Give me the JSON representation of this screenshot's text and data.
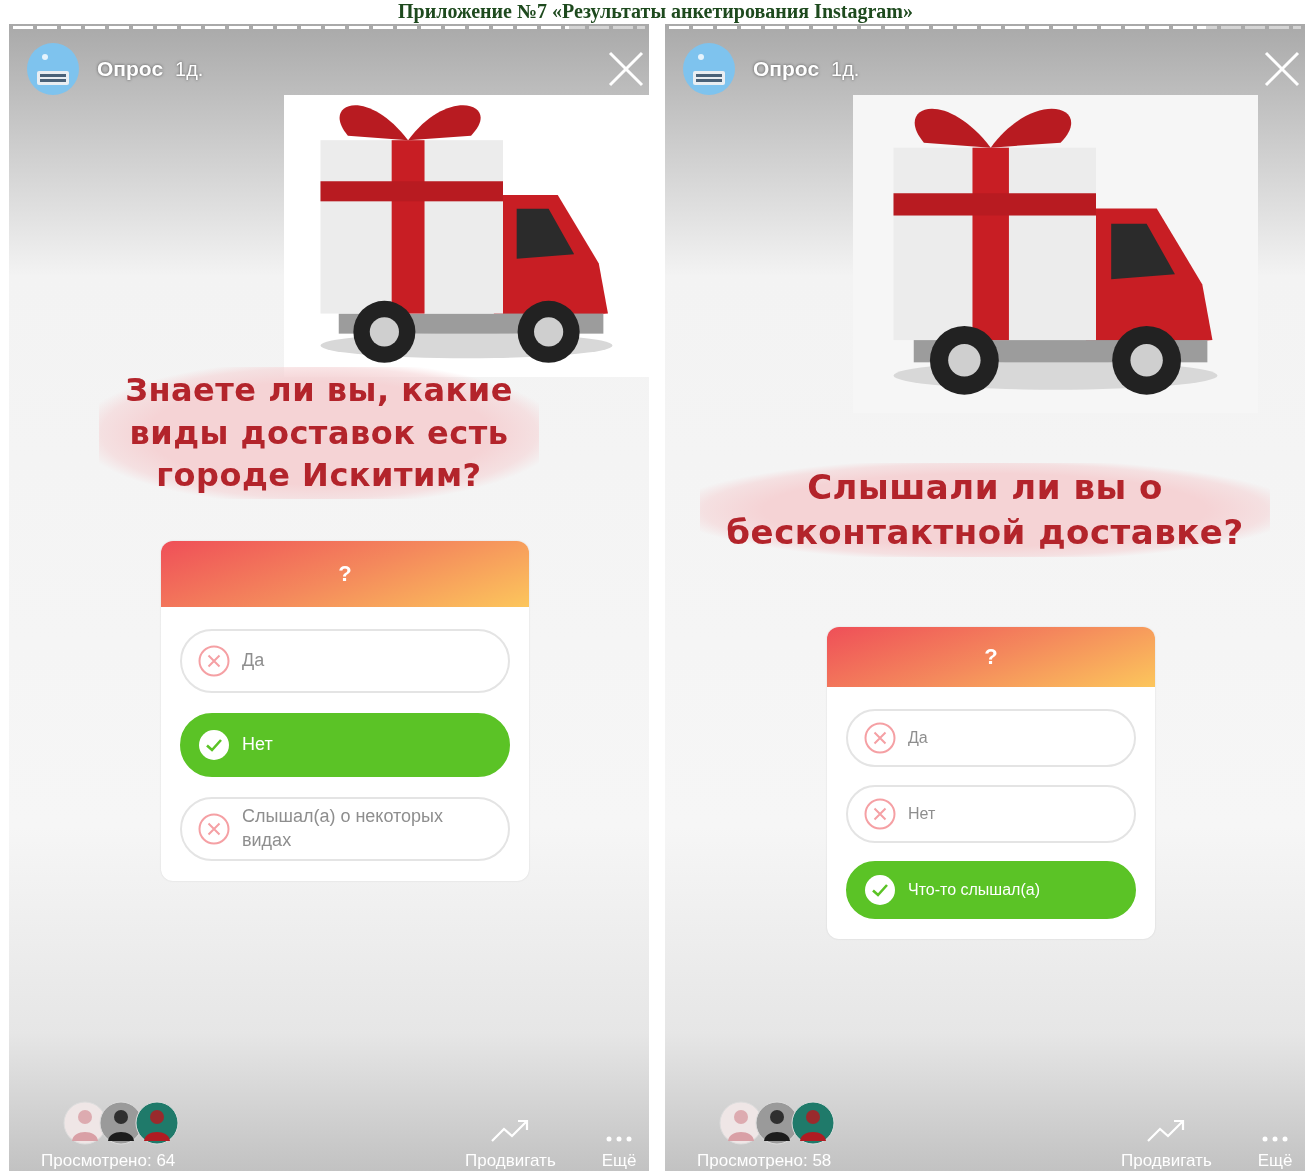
{
  "document_title": "Приложение №7 «Результаты анкетирования Instagram»",
  "stories": [
    {
      "progress": {
        "level": 0.88
      },
      "author": "Опрос",
      "age": "1д.",
      "question": "Знаете ли вы, какие\nвиды доставок есть\nгороде Искитим?",
      "poll": {
        "title": "?",
        "options": [
          {
            "label": "Да",
            "selected": false
          },
          {
            "label": "Нет",
            "selected": true
          },
          {
            "label": "Слышал(а) о некоторых видах",
            "selected": false
          }
        ]
      },
      "views": "Просмотрено: 64",
      "actions": [
        {
          "kind": "promote",
          "label": "Продвигать"
        },
        {
          "kind": "more",
          "label": "Ещё"
        }
      ]
    },
    {
      "progress": {
        "level": 0.85
      },
      "author": "Опрос",
      "age": "1д.",
      "question": "Слышали ли вы о\nбесконтактной доставке?",
      "poll": {
        "title": "?",
        "options": [
          {
            "label": "Да",
            "selected": false
          },
          {
            "label": "Нет",
            "selected": false
          },
          {
            "label": "Что-то слышал(а)",
            "selected": true
          }
        ]
      },
      "views": "Просмотрено: 58",
      "actions": [
        {
          "kind": "promote",
          "label": "Продвигать"
        },
        {
          "kind": "more",
          "label": "Ещё"
        }
      ]
    }
  ]
}
